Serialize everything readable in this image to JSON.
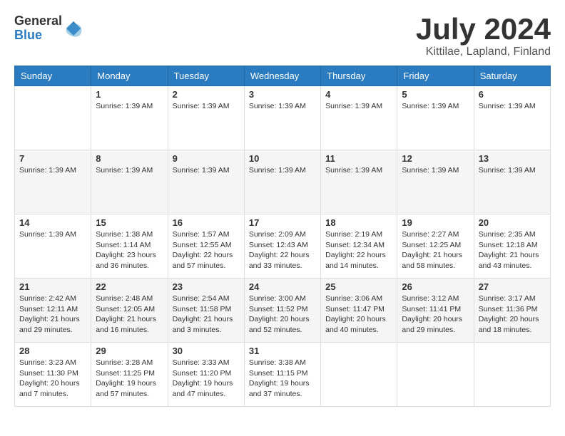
{
  "header": {
    "logo": {
      "general": "General",
      "blue": "Blue"
    },
    "title": "July 2024",
    "location": "Kittilae, Lapland, Finland"
  },
  "calendar": {
    "days_of_week": [
      "Sunday",
      "Monday",
      "Tuesday",
      "Wednesday",
      "Thursday",
      "Friday",
      "Saturday"
    ],
    "weeks": [
      [
        {
          "day": "",
          "info": ""
        },
        {
          "day": "1",
          "info": "Sunrise: 1:39 AM"
        },
        {
          "day": "2",
          "info": "Sunrise: 1:39 AM"
        },
        {
          "day": "3",
          "info": "Sunrise: 1:39 AM"
        },
        {
          "day": "4",
          "info": "Sunrise: 1:39 AM"
        },
        {
          "day": "5",
          "info": "Sunrise: 1:39 AM"
        },
        {
          "day": "6",
          "info": "Sunrise: 1:39 AM"
        }
      ],
      [
        {
          "day": "7",
          "info": "Sunrise: 1:39 AM"
        },
        {
          "day": "8",
          "info": "Sunrise: 1:39 AM"
        },
        {
          "day": "9",
          "info": "Sunrise: 1:39 AM"
        },
        {
          "day": "10",
          "info": "Sunrise: 1:39 AM"
        },
        {
          "day": "11",
          "info": "Sunrise: 1:39 AM"
        },
        {
          "day": "12",
          "info": "Sunrise: 1:39 AM"
        },
        {
          "day": "13",
          "info": "Sunrise: 1:39 AM"
        }
      ],
      [
        {
          "day": "14",
          "info": "Sunrise: 1:39 AM"
        },
        {
          "day": "15",
          "info": "Sunrise: 1:38 AM\nSunset: 1:14 AM\nDaylight: 23 hours and 36 minutes."
        },
        {
          "day": "16",
          "info": "Sunrise: 1:57 AM\nSunset: 12:55 AM\nDaylight: 22 hours and 57 minutes."
        },
        {
          "day": "17",
          "info": "Sunrise: 2:09 AM\nSunset: 12:43 AM\nDaylight: 22 hours and 33 minutes."
        },
        {
          "day": "18",
          "info": "Sunrise: 2:19 AM\nSunset: 12:34 AM\nDaylight: 22 hours and 14 minutes."
        },
        {
          "day": "19",
          "info": "Sunrise: 2:27 AM\nSunset: 12:25 AM\nDaylight: 21 hours and 58 minutes."
        },
        {
          "day": "20",
          "info": "Sunrise: 2:35 AM\nSunset: 12:18 AM\nDaylight: 21 hours and 43 minutes."
        }
      ],
      [
        {
          "day": "21",
          "info": "Sunrise: 2:42 AM\nSunset: 12:11 AM\nDaylight: 21 hours and 29 minutes."
        },
        {
          "day": "22",
          "info": "Sunrise: 2:48 AM\nSunset: 12:05 AM\nDaylight: 21 hours and 16 minutes."
        },
        {
          "day": "23",
          "info": "Sunrise: 2:54 AM\nSunset: 11:58 PM\nDaylight: 21 hours and 3 minutes."
        },
        {
          "day": "24",
          "info": "Sunrise: 3:00 AM\nSunset: 11:52 PM\nDaylight: 20 hours and 52 minutes."
        },
        {
          "day": "25",
          "info": "Sunrise: 3:06 AM\nSunset: 11:47 PM\nDaylight: 20 hours and 40 minutes."
        },
        {
          "day": "26",
          "info": "Sunrise: 3:12 AM\nSunset: 11:41 PM\nDaylight: 20 hours and 29 minutes."
        },
        {
          "day": "27",
          "info": "Sunrise: 3:17 AM\nSunset: 11:36 PM\nDaylight: 20 hours and 18 minutes."
        }
      ],
      [
        {
          "day": "28",
          "info": "Sunrise: 3:23 AM\nSunset: 11:30 PM\nDaylight: 20 hours and 7 minutes."
        },
        {
          "day": "29",
          "info": "Sunrise: 3:28 AM\nSunset: 11:25 PM\nDaylight: 19 hours and 57 minutes."
        },
        {
          "day": "30",
          "info": "Sunrise: 3:33 AM\nSunset: 11:20 PM\nDaylight: 19 hours and 47 minutes."
        },
        {
          "day": "31",
          "info": "Sunrise: 3:38 AM\nSunset: 11:15 PM\nDaylight: 19 hours and 37 minutes."
        },
        {
          "day": "",
          "info": ""
        },
        {
          "day": "",
          "info": ""
        },
        {
          "day": "",
          "info": ""
        }
      ]
    ]
  }
}
